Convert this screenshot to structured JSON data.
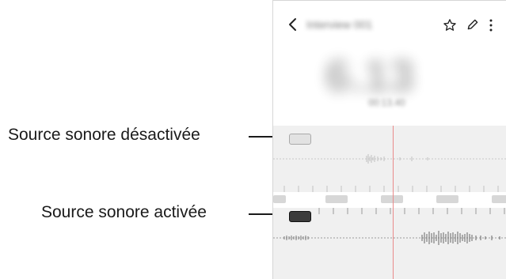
{
  "callouts": {
    "source_off": "Source sonore désactivée",
    "source_on": "Source sonore activée"
  },
  "header": {
    "title": "Interview 001",
    "back_icon": "chevron-left-icon",
    "star_icon": "star-icon",
    "edit_icon": "pen-icon",
    "more_icon": "more-vertical-icon"
  },
  "player": {
    "elapsed": "6.13",
    "date": "00:13.40"
  },
  "sources": [
    {
      "state": "off"
    },
    {
      "state": "on"
    }
  ],
  "colors": {
    "playhead": "#e98b8b",
    "panel_bg": "#f0f0f0",
    "toggle_on": "#3c3c3c",
    "toggle_off": "#e2e2e2"
  }
}
